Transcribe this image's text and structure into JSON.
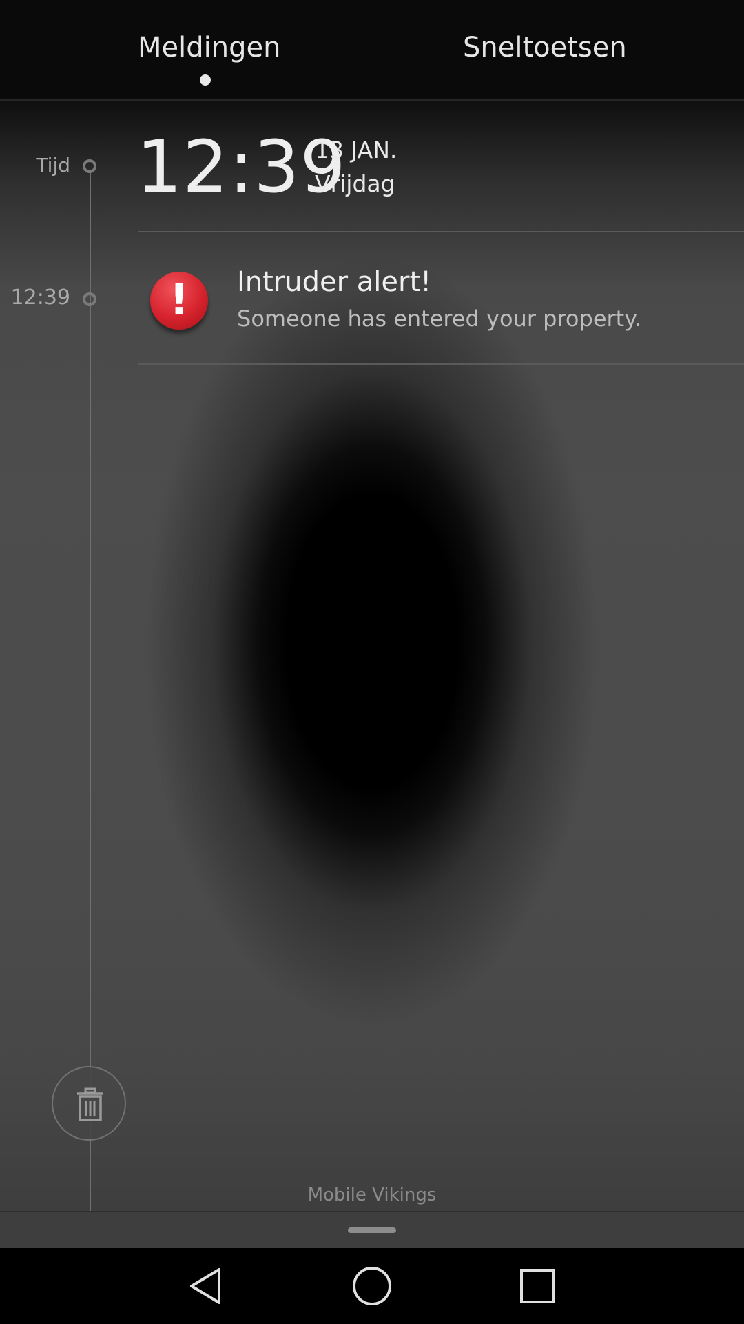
{
  "tabs": {
    "notifications_label": "Meldingen",
    "shortcuts_label": "Sneltoetsen",
    "active": "Meldingen"
  },
  "timeline": {
    "time_label": "Tijd",
    "clock": "12:39",
    "date": "13 JAN.",
    "weekday": "Vrijdag"
  },
  "notifications": [
    {
      "time": "12:39",
      "icon": "alert-icon",
      "icon_glyph": "!",
      "icon_color": "#d6232d",
      "title": "Intruder alert!",
      "body": "Someone has entered your property."
    }
  ],
  "footer": {
    "carrier": "Mobile Vikings",
    "clear_icon": "trash-icon"
  },
  "navbar": {
    "back_icon": "back-icon",
    "home_icon": "home-icon",
    "recents_icon": "recents-icon"
  }
}
